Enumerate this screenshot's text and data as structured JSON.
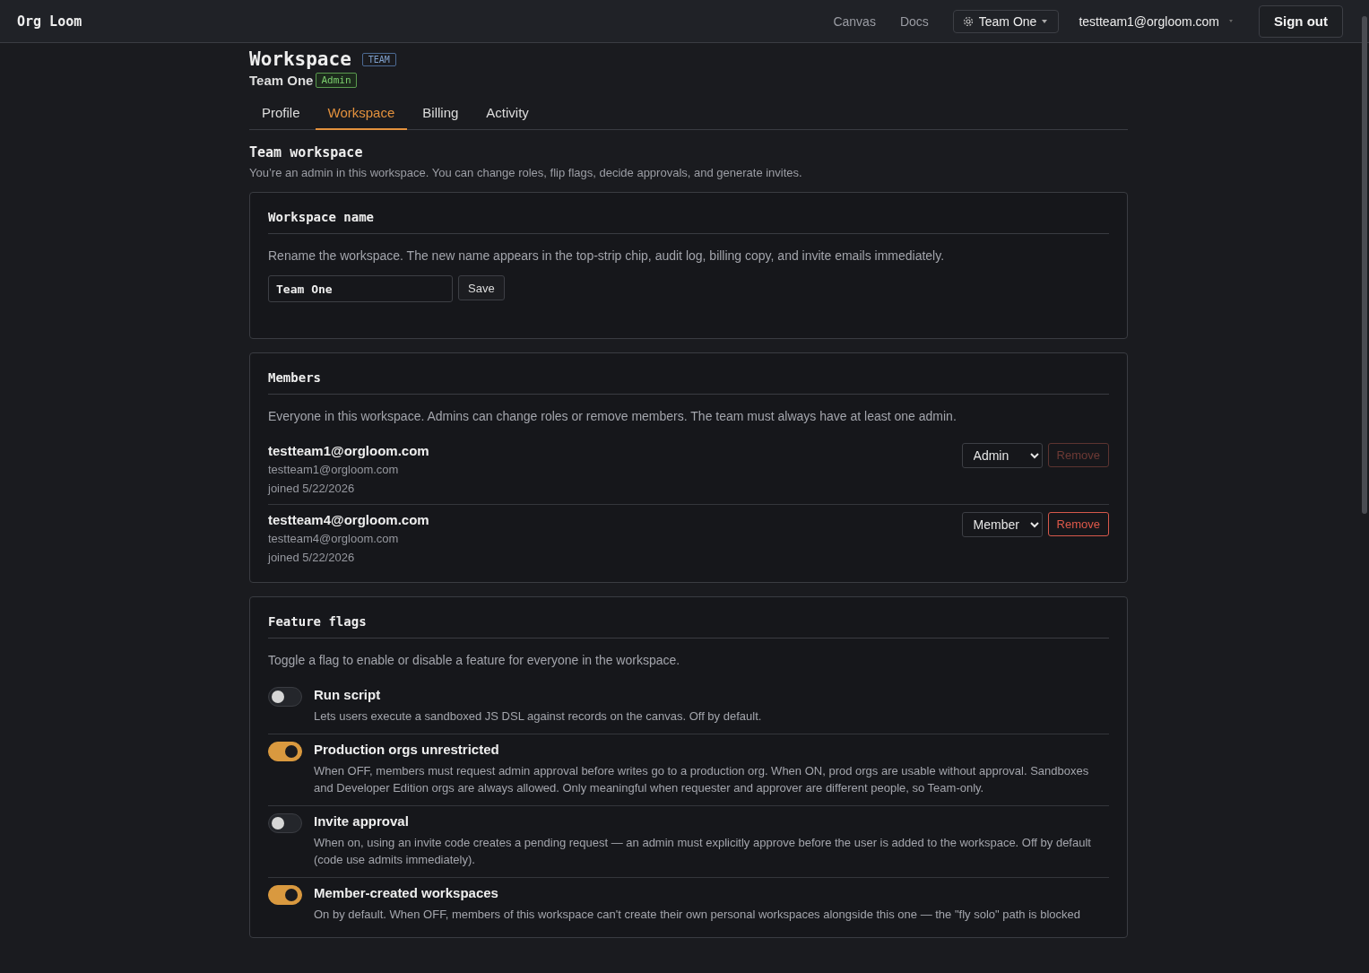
{
  "app": {
    "logo": "Org Loom"
  },
  "nav": {
    "links": [
      "Canvas",
      "Docs"
    ],
    "team_switcher": "Team One",
    "account": "testteam1@orgloom.com",
    "sign_out": "Sign out"
  },
  "page": {
    "title": "Workspace",
    "title_badge": "TEAM",
    "team_name": "Team One",
    "role_badge": "Admin"
  },
  "tabs": [
    {
      "label": "Profile",
      "selected": false
    },
    {
      "label": "Workspace",
      "selected": true
    },
    {
      "label": "Billing",
      "selected": false
    },
    {
      "label": "Activity",
      "selected": false
    }
  ],
  "section": {
    "title": "Team workspace",
    "description": "You’re an admin in this workspace. You can change roles, flip flags, decide approvals, and generate invites."
  },
  "workspace_name": {
    "title": "Workspace name",
    "description": "Rename the workspace. The new name appears in the top-strip chip, audit log, billing copy, and invite emails immediately.",
    "value": "Team One",
    "save": "Save"
  },
  "members": {
    "title": "Members",
    "description": "Everyone in this workspace. Admins can change roles or remove members. The team must always have at least one admin.",
    "rows": [
      {
        "name": "testteam1@orgloom.com",
        "email": "testteam1@orgloom.com",
        "joined": "joined 5/22/2026",
        "role": "Admin",
        "remove": "Remove",
        "remove_disabled": true
      },
      {
        "name": "testteam4@orgloom.com",
        "email": "testteam4@orgloom.com",
        "joined": "joined 5/22/2026",
        "role": "Member",
        "remove": "Remove",
        "remove_disabled": false
      }
    ]
  },
  "feature_flags": {
    "title": "Feature flags",
    "description": "Toggle a flag to enable or disable a feature for everyone in the workspace.",
    "flags": [
      {
        "name": "Run script",
        "description": "Lets users execute a sandboxed JS DSL against records on the canvas. Off by default.",
        "on": false
      },
      {
        "name": "Production orgs unrestricted",
        "description": "When OFF, members must request admin approval before writes go to a production org. When ON, prod orgs are usable without approval. Sandboxes and Developer Edition orgs are always allowed. Only meaningful when requester and approver are different people, so Team-only.",
        "on": true
      },
      {
        "name": "Invite approval",
        "description": "When on, using an invite code creates a pending request — an admin must explicitly approve before the user is added to the workspace. Off by default (code use admits immediately).",
        "on": false
      },
      {
        "name": "Member-created workspaces",
        "description": "On by default. When OFF, members of this workspace can't create their own personal workspaces alongside this one — the \"fly solo\" path is blocked",
        "on": true
      }
    ]
  }
}
